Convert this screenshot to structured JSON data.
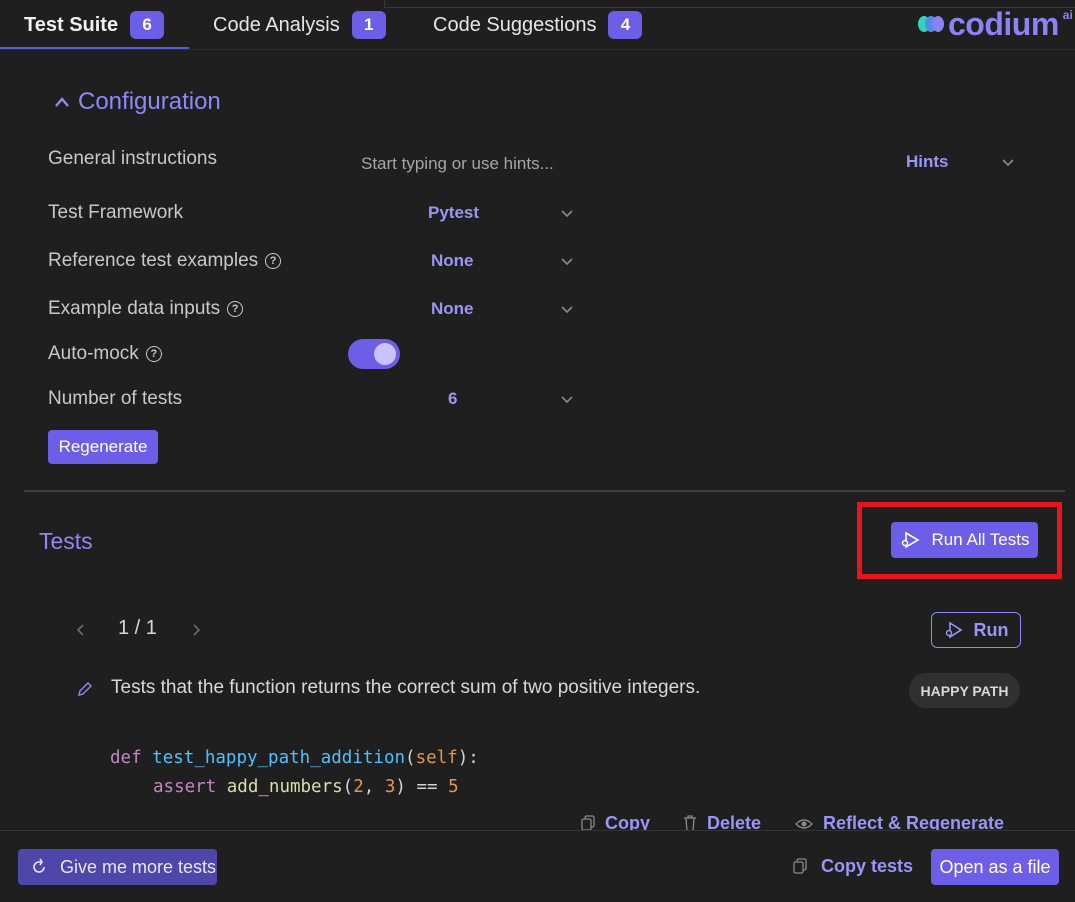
{
  "tabs": [
    {
      "label": "Test Suite",
      "count": "6"
    },
    {
      "label": "Code Analysis",
      "count": "1"
    },
    {
      "label": "Code Suggestions",
      "count": "4"
    }
  ],
  "logo": {
    "text": "codium",
    "suffix": "ai"
  },
  "configuration": {
    "title": "Configuration",
    "general_instructions": {
      "label": "General instructions",
      "placeholder": "Start typing or use hints...",
      "hints_label": "Hints"
    },
    "test_framework": {
      "label": "Test Framework",
      "value": "Pytest"
    },
    "reference_examples": {
      "label": "Reference test examples",
      "value": "None"
    },
    "example_data": {
      "label": "Example data inputs",
      "value": "None"
    },
    "auto_mock": {
      "label": "Auto-mock",
      "enabled": true
    },
    "number_of_tests": {
      "label": "Number of tests",
      "value": "6"
    },
    "regenerate_label": "Regenerate"
  },
  "tests": {
    "title": "Tests",
    "run_all_label": "Run All Tests",
    "pager": "1 / 1",
    "run_label": "Run",
    "description": "Tests that the function returns the correct sum of two positive integers.",
    "tag": "HAPPY PATH",
    "code_line1": {
      "def": "def",
      "name": "test_happy_path_addition",
      "open": "(",
      "self": "self",
      "close": "):"
    },
    "code_line2": {
      "assert": "assert",
      "call": "add_numbers",
      "open": "(",
      "a": "2",
      "sep": ", ",
      "b": "3",
      "close": ") == ",
      "result": "5"
    },
    "actions": {
      "copy": "Copy",
      "delete": "Delete",
      "reflect": "Reflect & Regenerate"
    }
  },
  "footer": {
    "more_tests_label": "Give me more tests",
    "copy_tests_label": "Copy tests",
    "open_file_label": "Open as a file"
  },
  "colors": {
    "accent": "#6d5ee8",
    "accent_text": "#8f88f6",
    "highlight": "#e8141d",
    "background": "#1f1f1f"
  }
}
